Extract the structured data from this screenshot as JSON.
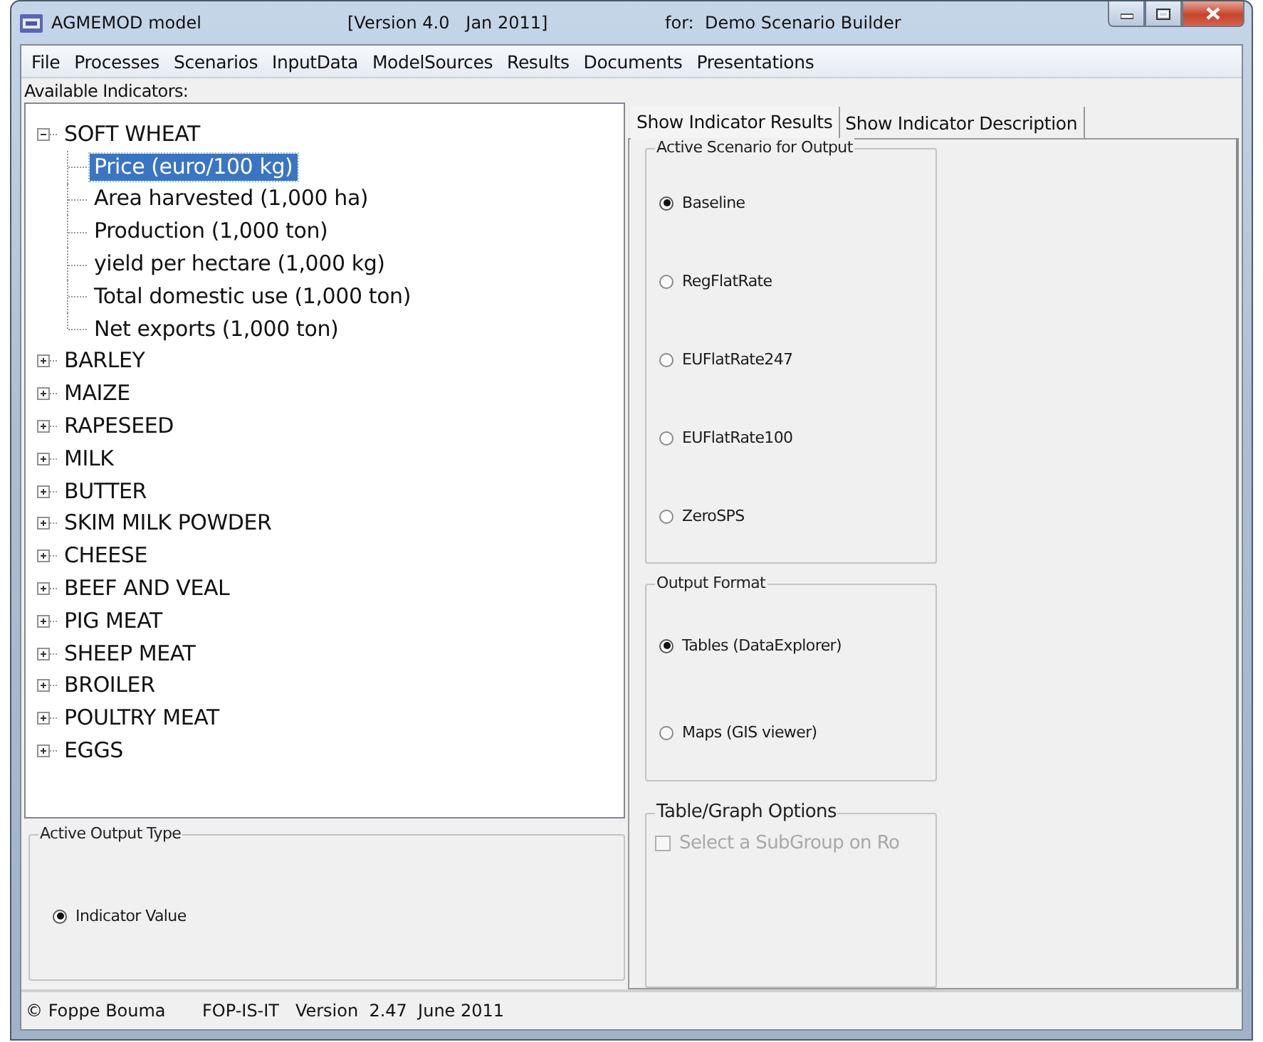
{
  "window": {
    "title": "AGMEMOD model",
    "version": "[Version 4.0   Jan 2011]",
    "scenario": "for:  Demo Scenario Builder"
  },
  "menu": [
    "File",
    "Processes",
    "Scenarios",
    "InputData",
    "ModelSources",
    "Results",
    "Documents",
    "Presentations"
  ],
  "indicators": {
    "label": "Available Indicators:",
    "tree": [
      {
        "label": "SOFT WHEAT",
        "expanded": true,
        "selected": false,
        "children": [
          {
            "label": "Price (euro/100 kg)",
            "selected": true
          },
          {
            "label": "Area harvested (1,000 ha)",
            "selected": false
          },
          {
            "label": "Production (1,000 ton)",
            "selected": false
          },
          {
            "label": "yield per hectare (1,000 kg)",
            "selected": false
          },
          {
            "label": "Total domestic use (1,000 ton)",
            "selected": false
          },
          {
            "label": "Net exports (1,000 ton)",
            "selected": false
          }
        ]
      },
      {
        "label": "BARLEY",
        "expanded": false,
        "selected": false
      },
      {
        "label": "MAIZE",
        "expanded": false,
        "selected": false
      },
      {
        "label": "RAPESEED",
        "expanded": false,
        "selected": false
      },
      {
        "label": "MILK",
        "expanded": false,
        "selected": false
      },
      {
        "label": "BUTTER",
        "expanded": false,
        "selected": false
      },
      {
        "label": "SKIM MILK POWDER",
        "expanded": false,
        "selected": false
      },
      {
        "label": "CHEESE",
        "expanded": false,
        "selected": false
      },
      {
        "label": "BEEF AND VEAL",
        "expanded": false,
        "selected": false
      },
      {
        "label": "PIG MEAT",
        "expanded": false,
        "selected": false
      },
      {
        "label": "SHEEP MEAT",
        "expanded": false,
        "selected": false
      },
      {
        "label": "BROILER",
        "expanded": false,
        "selected": false
      },
      {
        "label": "POULTRY MEAT",
        "expanded": false,
        "selected": false
      },
      {
        "label": "EGGS",
        "expanded": false,
        "selected": false
      }
    ]
  },
  "output_type": {
    "title": "Active Output Type",
    "options": [
      {
        "label": "Indicator Value",
        "selected": true
      }
    ]
  },
  "tabs": [
    {
      "label": "Show Indicator Results",
      "selected": true
    },
    {
      "label": "Show Indicator Description",
      "selected": false
    }
  ],
  "scenario_group": {
    "title": "Active Scenario for Output",
    "options": [
      {
        "label": "Baseline",
        "selected": true
      },
      {
        "label": "RegFlatRate",
        "selected": false
      },
      {
        "label": "EUFlatRate247",
        "selected": false
      },
      {
        "label": "EUFlatRate100",
        "selected": false
      },
      {
        "label": "ZeroSPS",
        "selected": false
      }
    ]
  },
  "format_group": {
    "title": "Output Format",
    "options": [
      {
        "label": "Tables (DataExplorer)",
        "selected": true
      },
      {
        "label": "Maps (GIS viewer)",
        "selected": false
      }
    ]
  },
  "options_group": {
    "title": "Table/Graph Options",
    "checkboxes": [
      {
        "label": "Select a SubGroup on Ro",
        "checked": false,
        "disabled": true
      }
    ]
  },
  "status_bar": [
    "© Foppe Bouma",
    "FOP-IS-IT   Version  2.47  June 2011"
  ]
}
